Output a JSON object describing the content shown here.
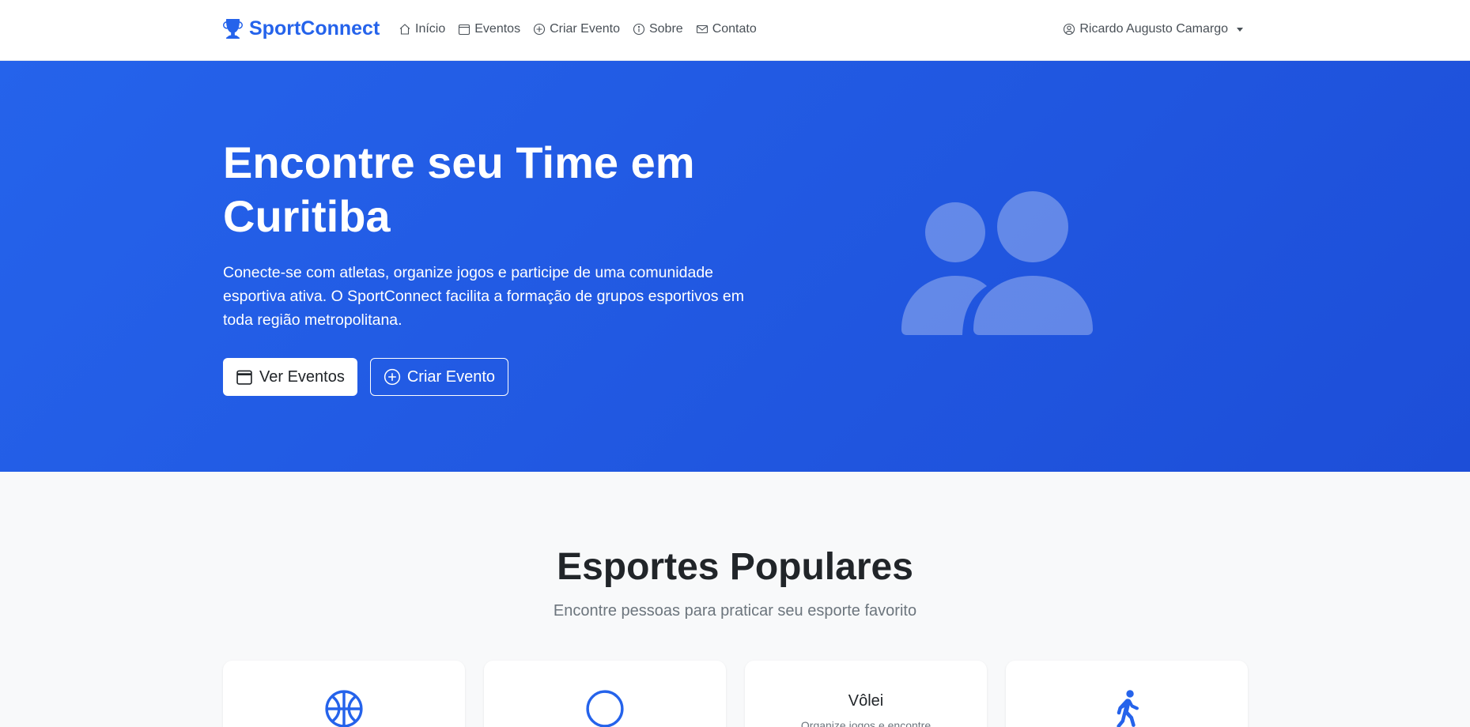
{
  "navbar": {
    "brand": "SportConnect",
    "links": [
      {
        "label": "Início",
        "icon": "house-icon"
      },
      {
        "label": "Eventos",
        "icon": "calendar-icon"
      },
      {
        "label": "Criar Evento",
        "icon": "plus-circle-icon"
      },
      {
        "label": "Sobre",
        "icon": "info-circle-icon"
      },
      {
        "label": "Contato",
        "icon": "envelope-icon"
      }
    ],
    "user_name": "Ricardo Augusto Camargo"
  },
  "hero": {
    "title": "Encontre seu Time em Curitiba",
    "description": "Conecte-se com atletas, organize jogos e participe de uma comunidade esportiva ativa. O SportConnect facilita a formação de grupos esportivos em toda região metropolitana.",
    "primary_button": "Ver Eventos",
    "secondary_button": "Criar Evento"
  },
  "sports": {
    "title": "Esportes Populares",
    "subtitle": "Encontre pessoas para praticar seu esporte favorito",
    "cards": [
      {
        "icon": "basketball-icon"
      },
      {
        "icon": "circle-icon"
      },
      {
        "title": "Vôlei",
        "description": "Organize jogos e encontre"
      },
      {
        "icon": "person-walking-icon"
      }
    ]
  },
  "colors": {
    "primary": "#2563eb",
    "hero_gradient_start": "#2563eb",
    "hero_gradient_end": "#1d4ed8",
    "section_bg": "#f8f9fa"
  }
}
